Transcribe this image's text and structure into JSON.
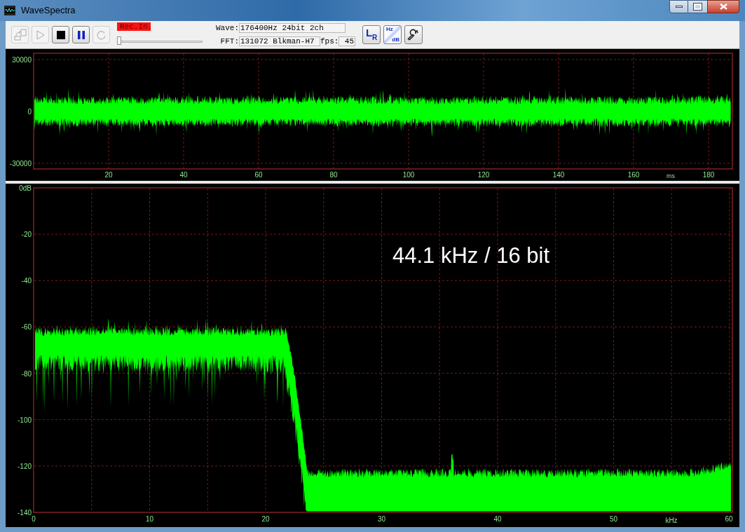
{
  "window": {
    "title": "WaveSpectra",
    "controls": [
      {
        "kind": "minimize"
      },
      {
        "kind": "maximize"
      },
      {
        "kind": "close"
      }
    ]
  },
  "toolbar": {
    "buttons": [
      {
        "kind": "export",
        "disabled": true
      },
      {
        "kind": "play",
        "disabled": true
      },
      {
        "kind": "stop",
        "disabled": false
      },
      {
        "kind": "pause",
        "disabled": false
      },
      {
        "kind": "record",
        "disabled": true
      }
    ],
    "rec_input": {
      "label": "Rec.In.",
      "level": 0
    },
    "wave": {
      "label": "Wave:",
      "value": "176400Hz 24bit 2ch"
    },
    "fft": {
      "label": "FFT:",
      "value": "131072 Blkman-H7"
    },
    "fps": {
      "label": "fps:",
      "value": "45"
    },
    "tool_buttons": [
      {
        "kind": "channels",
        "labels": [
          "L",
          "R"
        ]
      },
      {
        "kind": "scale",
        "labels": [
          "Hz",
          "dB"
        ]
      },
      {
        "kind": "settings"
      }
    ]
  },
  "waveform": {
    "y_ticks": [
      "30000",
      "0",
      "-30000"
    ],
    "x_ticks": [
      "20",
      "40",
      "60",
      "80",
      "100",
      "120",
      "140",
      "160",
      "180"
    ],
    "x_unit": "ms"
  },
  "spectrum": {
    "y_ticks": [
      "0dB",
      "-20",
      "-40",
      "-60",
      "-80",
      "-100",
      "-120",
      "-140"
    ],
    "x_ticks": [
      "0",
      "10",
      "20",
      "30",
      "40",
      "50",
      "60"
    ],
    "x_unit": "kHz",
    "annotation": "44.1 kHz / 16 bit"
  }
}
